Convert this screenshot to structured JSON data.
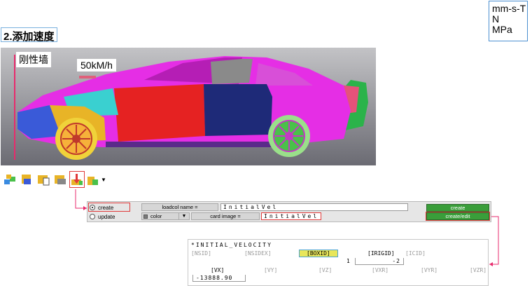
{
  "units": [
    "mm-s-T",
    "N",
    "MPa"
  ],
  "step_title": "2.添加速度",
  "viewport": {
    "wall_label": "刚性墙",
    "speed_label": "50kM/h"
  },
  "toolbar": {
    "icons": [
      "load-collector-icon",
      "load-step-icon",
      "output-block-icon",
      "load-set-icon",
      "initial-velocity-icon",
      "vector-dropdown-icon"
    ]
  },
  "panel": {
    "mode_create": "create",
    "mode_update": "update",
    "loadcol_name_label": "loadcol name =",
    "loadcol_name_value": "InitialVel",
    "color_label": "color",
    "card_image_label": "card image =",
    "card_image_value": "InitialVel",
    "create_button": "create",
    "create_edit_button": "create/edit"
  },
  "card": {
    "title": "*INITIAL_VELOCITY",
    "labels": {
      "nsid": "[NSID]",
      "nsidex": "[NSIDEX]",
      "boxid": "[BOXID]",
      "irigid": "[IRIGID]",
      "icid": "[ICID]",
      "vx": "[VX]",
      "vy": "[VY]",
      "vz": "[VZ]",
      "vxr": "[VXR]",
      "vyr": "[VYR]",
      "vzr": "[VZR]"
    },
    "boxid_value": "1",
    "irigid_value": "-2",
    "vx_value": "-13888.90"
  },
  "colors": {
    "highlight": "#e03a3a",
    "create_green": "#3a9e3a",
    "connector": "#e82a6c"
  }
}
